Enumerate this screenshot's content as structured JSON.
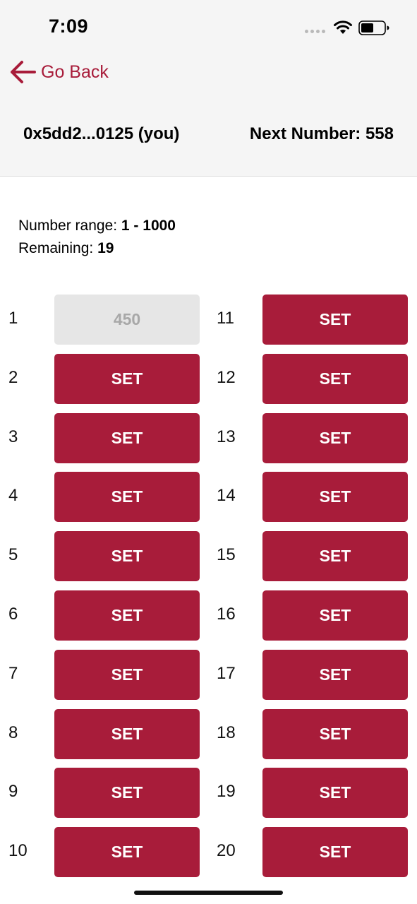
{
  "status_bar": {
    "time": "7:09",
    "icons": [
      "signal-dots-icon",
      "wifi-icon",
      "battery-icon"
    ]
  },
  "nav": {
    "back_label": "Go Back",
    "back_icon": "arrow-left-icon"
  },
  "header": {
    "account": "0x5dd2...0125 (you)",
    "next_number_label": "Next Number:",
    "next_number_value": "558"
  },
  "info": {
    "range_label": "Number range:",
    "range_value": "1 - 1000",
    "remaining_label": "Remaining:",
    "remaining_value": "19"
  },
  "slots": [
    {
      "index": "1",
      "label": "450",
      "filled": true
    },
    {
      "index": "2",
      "label": "SET",
      "filled": false
    },
    {
      "index": "3",
      "label": "SET",
      "filled": false
    },
    {
      "index": "4",
      "label": "SET",
      "filled": false
    },
    {
      "index": "5",
      "label": "SET",
      "filled": false
    },
    {
      "index": "6",
      "label": "SET",
      "filled": false
    },
    {
      "index": "7",
      "label": "SET",
      "filled": false
    },
    {
      "index": "8",
      "label": "SET",
      "filled": false
    },
    {
      "index": "9",
      "label": "SET",
      "filled": false
    },
    {
      "index": "10",
      "label": "SET",
      "filled": false
    },
    {
      "index": "11",
      "label": "SET",
      "filled": false
    },
    {
      "index": "12",
      "label": "SET",
      "filled": false
    },
    {
      "index": "13",
      "label": "SET",
      "filled": false
    },
    {
      "index": "14",
      "label": "SET",
      "filled": false
    },
    {
      "index": "15",
      "label": "SET",
      "filled": false
    },
    {
      "index": "16",
      "label": "SET",
      "filled": false
    },
    {
      "index": "17",
      "label": "SET",
      "filled": false
    },
    {
      "index": "18",
      "label": "SET",
      "filled": false
    },
    {
      "index": "19",
      "label": "SET",
      "filled": false
    },
    {
      "index": "20",
      "label": "SET",
      "filled": false
    }
  ],
  "colors": {
    "accent": "#a81c3a",
    "filled_button": "#e6e6e6",
    "filled_text": "#a8a8a8",
    "header_bg": "#f5f5f5"
  }
}
